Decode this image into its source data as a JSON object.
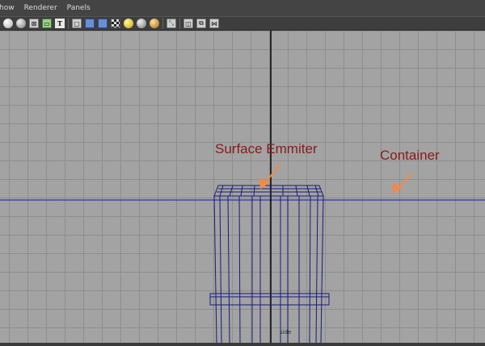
{
  "menu": {
    "items": [
      "how",
      "Renderer",
      "Panels"
    ]
  },
  "toolbar": {
    "icons": [
      "camera-icon",
      "camera-attribute-icon",
      "grid-icon",
      "film-gate-icon",
      "resolution-gate-icon",
      "isolate-select-icon",
      "wireframe-icon",
      "smooth-shade-icon",
      "texture-icon",
      "default-light-icon",
      "all-lights-icon",
      "shadows-icon",
      "screen-space-ao-icon",
      "select-camera-icon",
      "xray-icon",
      "xray-joints-icon",
      "hud-icon"
    ]
  },
  "viewport": {
    "annotations": {
      "emitter": "Surface Emmiter",
      "container": "Container"
    },
    "camera_label": "side"
  }
}
